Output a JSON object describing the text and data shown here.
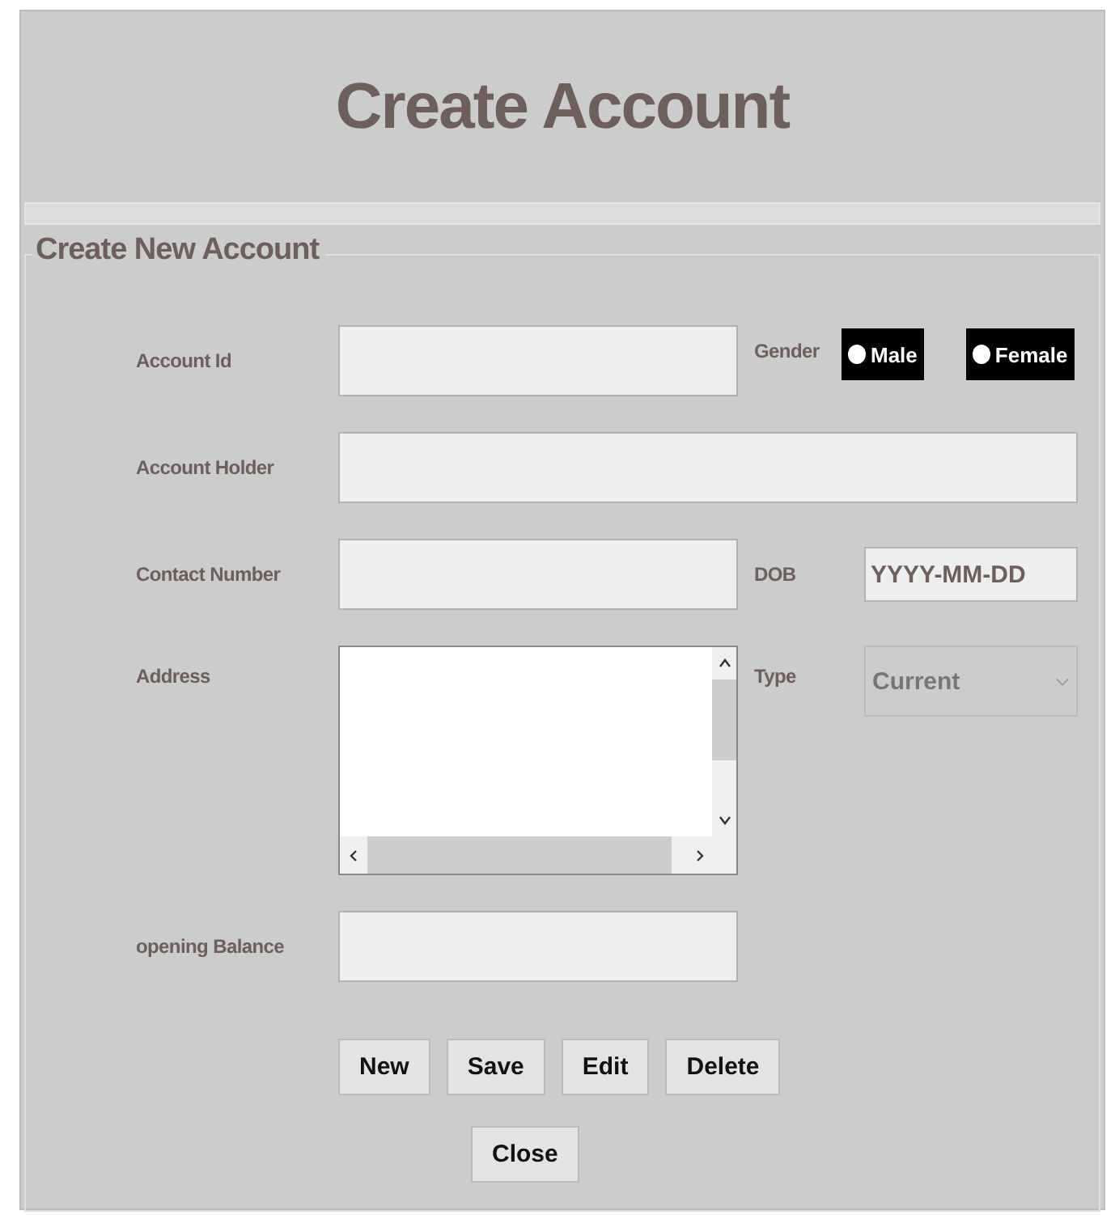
{
  "window": {
    "title": "Create Account"
  },
  "group": {
    "legend": "Create New Account"
  },
  "fields": {
    "account_id": {
      "label": "Account Id"
    },
    "gender": {
      "label": "Gender",
      "options": [
        {
          "label": "Male",
          "selected": false
        },
        {
          "label": "Female",
          "selected": false
        }
      ]
    },
    "account_holder": {
      "label": "Account Holder"
    },
    "contact_number": {
      "label": "Contact Number"
    },
    "dob": {
      "label": "DOB",
      "value": "YYYY-MM-DD"
    },
    "address": {
      "label": "Address"
    },
    "type": {
      "label": "Type",
      "value": "Current",
      "disabled": true
    },
    "opening_balance": {
      "label": "opening Balance"
    }
  },
  "buttons": [
    "New",
    "Save",
    "Edit",
    "Delete"
  ],
  "close_button": "Close"
}
